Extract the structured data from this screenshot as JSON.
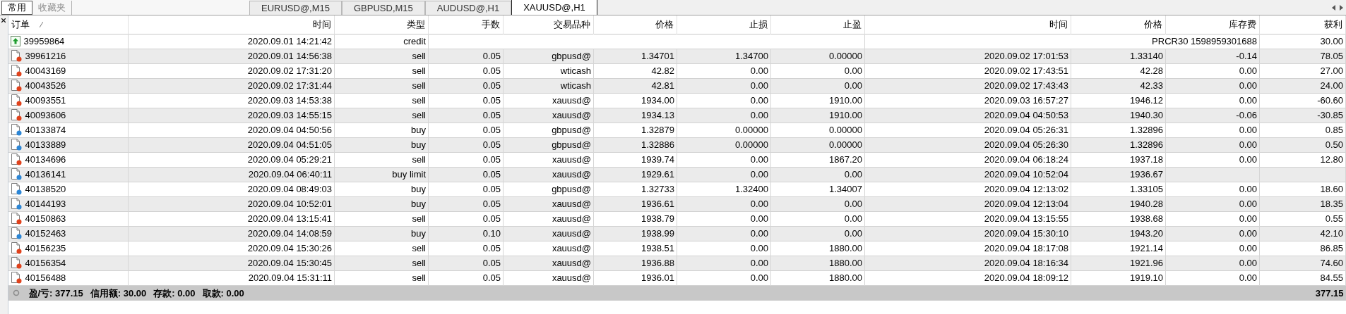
{
  "left_tabs": [
    {
      "label": "常用",
      "selected": true
    },
    {
      "label": "收藏夹",
      "selected": false
    }
  ],
  "chart_tabs": [
    {
      "label": "EURUSD@,M15",
      "selected": false
    },
    {
      "label": "GBPUSD,M15",
      "selected": false
    },
    {
      "label": "AUDUSD@,H1",
      "selected": false
    },
    {
      "label": "XAUUSD@,H1",
      "selected": true
    }
  ],
  "table": {
    "columns": [
      "订单",
      "时间",
      "类型",
      "手数",
      "交易品种",
      "价格",
      "止损",
      "止盈",
      "时间",
      "价格",
      "库存费",
      "获利"
    ],
    "rows": [
      {
        "kind": "balance",
        "cells": [
          "39959864",
          "2020.09.01 14:21:42",
          "credit"
        ],
        "comment": "PRCR30 1598959301688",
        "profit": "30.00"
      },
      {
        "kind": "sell",
        "cells": [
          "39961216",
          "2020.09.01 14:56:38",
          "sell",
          "0.05",
          "gbpusd@",
          "1.34701",
          "1.34700",
          "0.00000",
          "2020.09.02 17:01:53",
          "1.33140",
          "-0.14",
          "78.05"
        ]
      },
      {
        "kind": "sell",
        "cells": [
          "40043169",
          "2020.09.02 17:31:20",
          "sell",
          "0.05",
          "wticash",
          "42.82",
          "0.00",
          "0.00",
          "2020.09.02 17:43:51",
          "42.28",
          "0.00",
          "27.00"
        ]
      },
      {
        "kind": "sell",
        "cells": [
          "40043526",
          "2020.09.02 17:31:44",
          "sell",
          "0.05",
          "wticash",
          "42.81",
          "0.00",
          "0.00",
          "2020.09.02 17:43:43",
          "42.33",
          "0.00",
          "24.00"
        ]
      },
      {
        "kind": "sell",
        "cells": [
          "40093551",
          "2020.09.03 14:53:38",
          "sell",
          "0.05",
          "xauusd@",
          "1934.00",
          "0.00",
          "1910.00",
          "2020.09.03 16:57:27",
          "1946.12",
          "0.00",
          "-60.60"
        ]
      },
      {
        "kind": "sell",
        "cells": [
          "40093606",
          "2020.09.03 14:55:15",
          "sell",
          "0.05",
          "xauusd@",
          "1934.13",
          "0.00",
          "1910.00",
          "2020.09.04 04:50:53",
          "1940.30",
          "-0.06",
          "-30.85"
        ]
      },
      {
        "kind": "buy",
        "cells": [
          "40133874",
          "2020.09.04 04:50:56",
          "buy",
          "0.05",
          "gbpusd@",
          "1.32879",
          "0.00000",
          "0.00000",
          "2020.09.04 05:26:31",
          "1.32896",
          "0.00",
          "0.85"
        ]
      },
      {
        "kind": "buy",
        "cells": [
          "40133889",
          "2020.09.04 04:51:05",
          "buy",
          "0.05",
          "gbpusd@",
          "1.32886",
          "0.00000",
          "0.00000",
          "2020.09.04 05:26:30",
          "1.32896",
          "0.00",
          "0.50"
        ]
      },
      {
        "kind": "sell",
        "cells": [
          "40134696",
          "2020.09.04 05:29:21",
          "sell",
          "0.05",
          "xauusd@",
          "1939.74",
          "0.00",
          "1867.20",
          "2020.09.04 06:18:24",
          "1937.18",
          "0.00",
          "12.80"
        ]
      },
      {
        "kind": "buy",
        "cells": [
          "40136141",
          "2020.09.04 06:40:11",
          "buy limit",
          "0.05",
          "xauusd@",
          "1929.61",
          "0.00",
          "0.00",
          "2020.09.04 10:52:04",
          "1936.67",
          null,
          null
        ]
      },
      {
        "kind": "buy",
        "cells": [
          "40138520",
          "2020.09.04 08:49:03",
          "buy",
          "0.05",
          "gbpusd@",
          "1.32733",
          "1.32400",
          "1.34007",
          "2020.09.04 12:13:02",
          "1.33105",
          "0.00",
          "18.60"
        ]
      },
      {
        "kind": "buy",
        "cells": [
          "40144193",
          "2020.09.04 10:52:01",
          "buy",
          "0.05",
          "xauusd@",
          "1936.61",
          "0.00",
          "0.00",
          "2020.09.04 12:13:04",
          "1940.28",
          "0.00",
          "18.35"
        ]
      },
      {
        "kind": "sell",
        "cells": [
          "40150863",
          "2020.09.04 13:15:41",
          "sell",
          "0.05",
          "xauusd@",
          "1938.79",
          "0.00",
          "0.00",
          "2020.09.04 13:15:55",
          "1938.68",
          "0.00",
          "0.55"
        ]
      },
      {
        "kind": "buy",
        "cells": [
          "40152463",
          "2020.09.04 14:08:59",
          "buy",
          "0.10",
          "xauusd@",
          "1938.99",
          "0.00",
          "0.00",
          "2020.09.04 15:30:10",
          "1943.20",
          "0.00",
          "42.10"
        ]
      },
      {
        "kind": "sell",
        "cells": [
          "40156235",
          "2020.09.04 15:30:26",
          "sell",
          "0.05",
          "xauusd@",
          "1938.51",
          "0.00",
          "1880.00",
          "2020.09.04 18:17:08",
          "1921.14",
          "0.00",
          "86.85"
        ]
      },
      {
        "kind": "sell",
        "cells": [
          "40156354",
          "2020.09.04 15:30:45",
          "sell",
          "0.05",
          "xauusd@",
          "1936.88",
          "0.00",
          "1880.00",
          "2020.09.04 18:16:34",
          "1921.96",
          "0.00",
          "74.60"
        ]
      },
      {
        "kind": "sell",
        "cells": [
          "40156488",
          "2020.09.04 15:31:11",
          "sell",
          "0.05",
          "xauusd@",
          "1936.01",
          "0.00",
          "1880.00",
          "2020.09.04 18:09:12",
          "1919.10",
          "0.00",
          "84.55"
        ]
      }
    ]
  },
  "summary": {
    "items": [
      "盈/亏: 377.15",
      "信用额: 30.00",
      "存款: 0.00",
      "取款: 0.00"
    ],
    "total": "377.15"
  }
}
